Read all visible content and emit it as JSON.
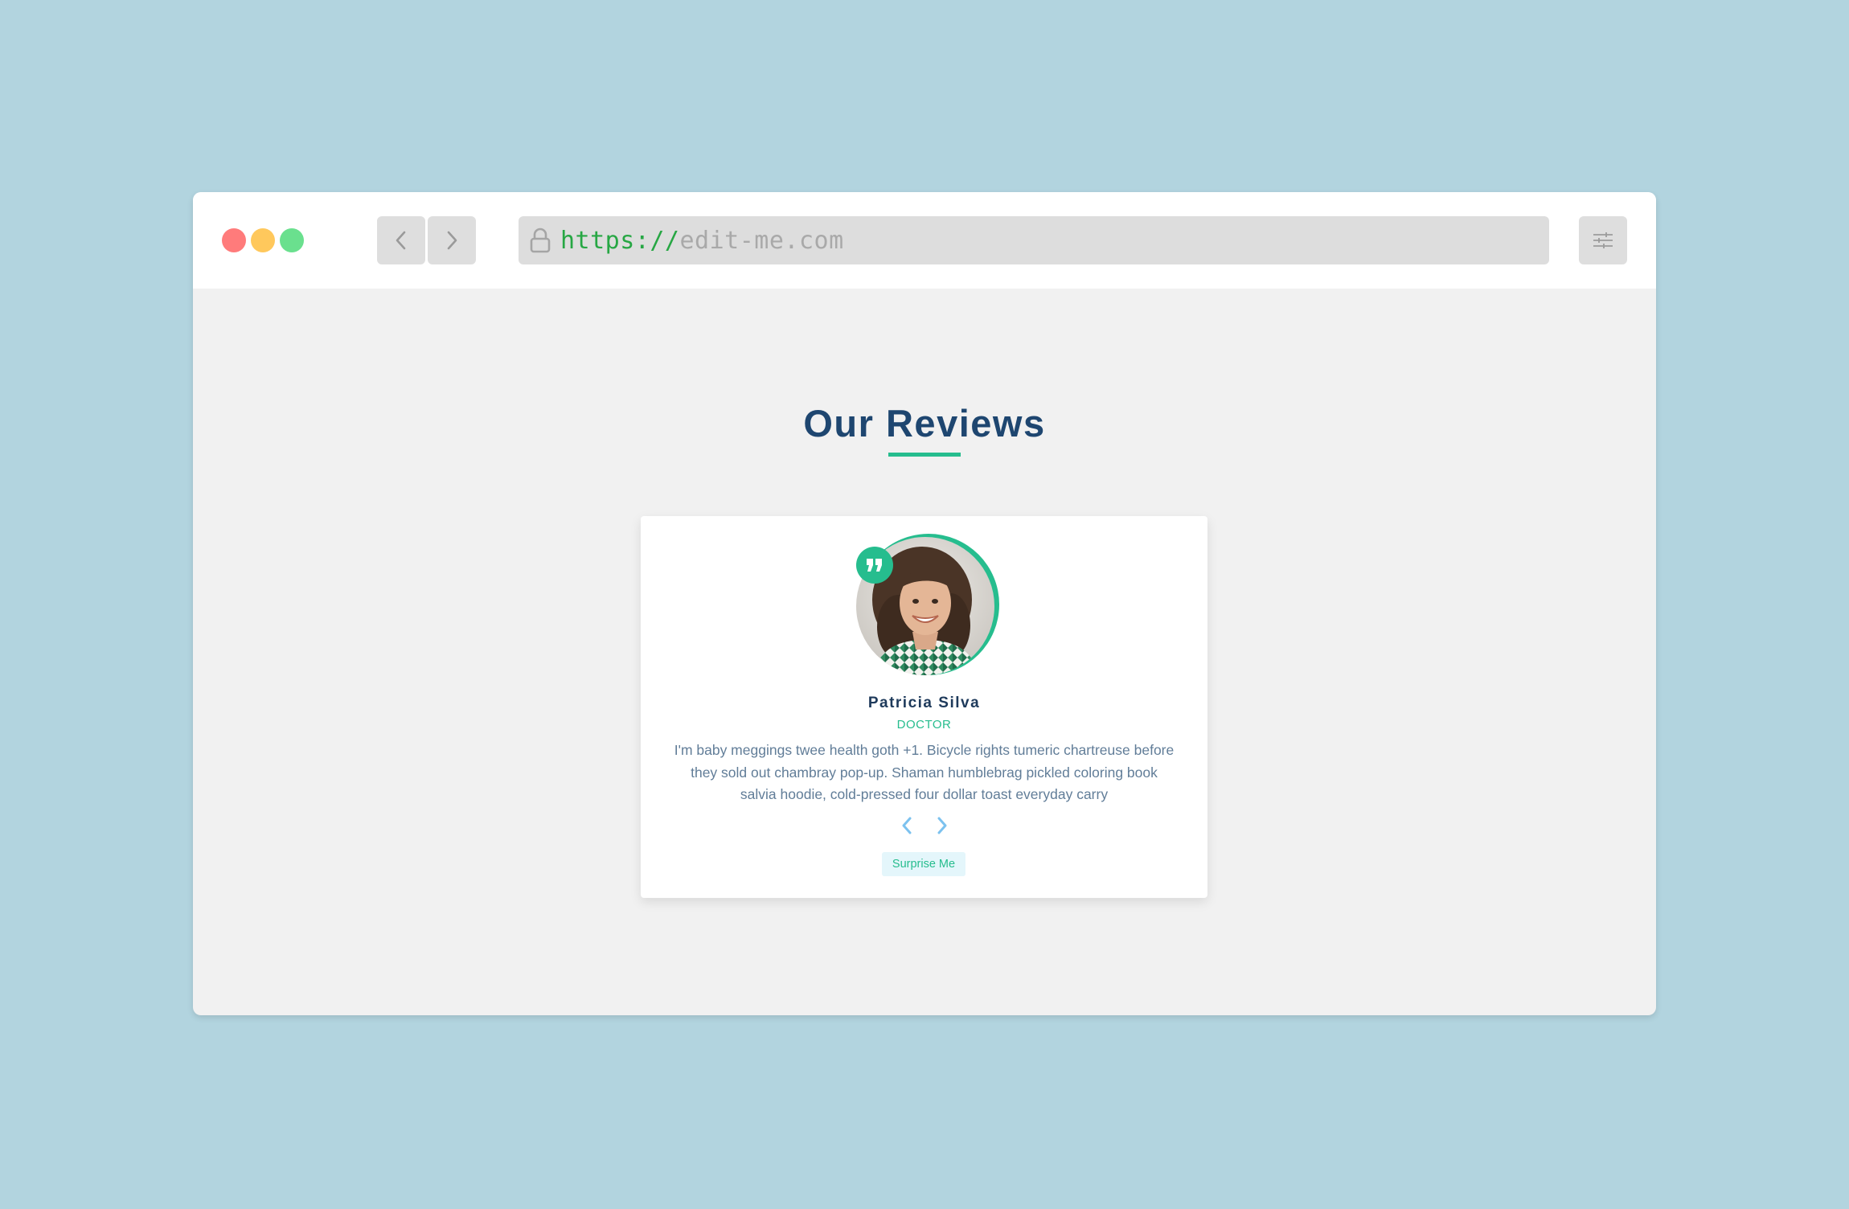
{
  "browser": {
    "url_scheme": "https://",
    "url_host": "edit-me.com",
    "traffic_lights": {
      "close": "#ff5f57",
      "minimize": "#ffbd2e",
      "maximize": "#28c840"
    },
    "icons": {
      "back": "chevron-left-icon",
      "forward": "chevron-right-icon",
      "lock": "lock-icon",
      "menu": "sliders-icon"
    }
  },
  "page": {
    "title": "Our Reviews",
    "accent_color": "#26bd8e",
    "title_color": "#1e4670"
  },
  "review": {
    "name": "Patricia Silva",
    "job": "DOCTOR",
    "text": "I'm baby meggings twee health goth +1. Bicycle rights tumeric chartreuse before they sold out chambray pop-up. Shaman humblebrag pickled coloring book salvia hoodie, cold-pressed four dollar toast everyday carry",
    "avatar_icon": "person-photo",
    "quote_icon": "quote-icon",
    "prev_icon": "chevron-left-icon",
    "next_icon": "chevron-right-icon",
    "random_label": "Surprise Me"
  }
}
